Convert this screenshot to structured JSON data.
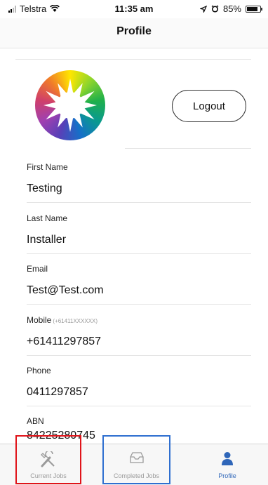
{
  "status_bar": {
    "carrier": "Telstra",
    "time": "11:35 am",
    "battery": "85%",
    "battery_level": 0.85
  },
  "nav": {
    "title": "Profile"
  },
  "profile": {
    "logout_label": "Logout"
  },
  "fields": [
    {
      "label": "First Name",
      "hint": "",
      "value": "Testing"
    },
    {
      "label": "Last Name",
      "hint": "",
      "value": "Installer"
    },
    {
      "label": "Email",
      "hint": "",
      "value": "Test@Test.com"
    },
    {
      "label": "Mobile",
      "hint": "(+61411XXXXXX)",
      "value": "+61411297857"
    },
    {
      "label": "Phone",
      "hint": "",
      "value": "0411297857"
    },
    {
      "label": "ABN",
      "hint": "",
      "value": "84225280745"
    }
  ],
  "tabs": [
    {
      "label": "Current Jobs",
      "icon": "tools-icon"
    },
    {
      "label": "Completed Jobs",
      "icon": "inbox-icon"
    },
    {
      "label": "Profile",
      "icon": "person-icon"
    }
  ],
  "colors": {
    "accent": "#2f66b9",
    "highlight_red": "#e0141a",
    "highlight_blue": "#2f6fd0"
  }
}
